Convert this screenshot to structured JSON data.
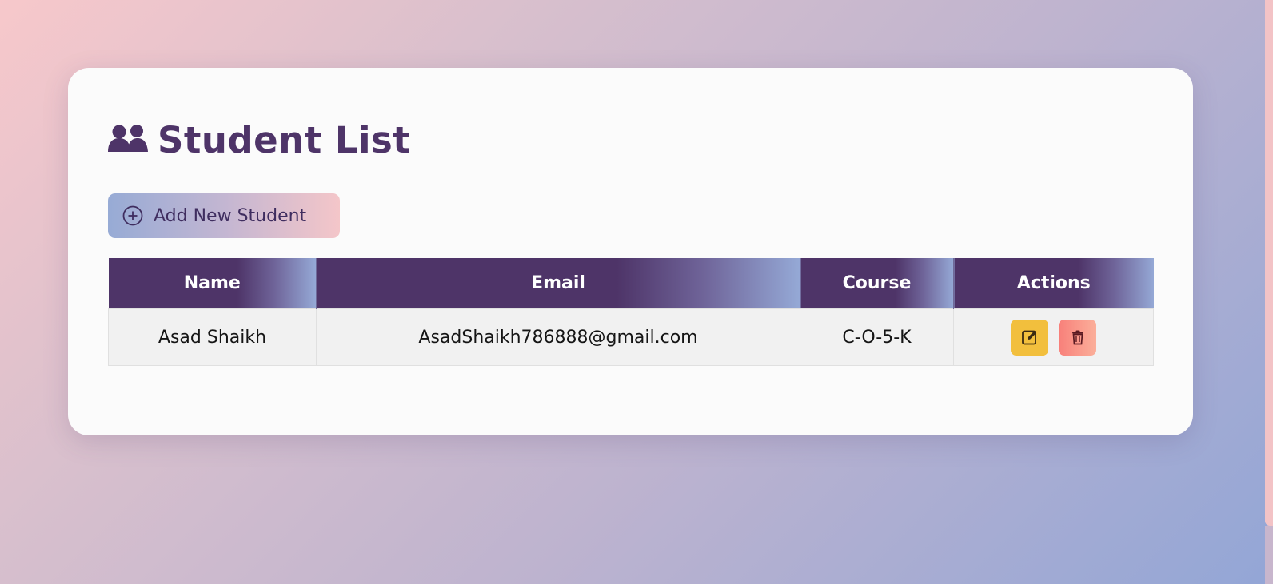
{
  "page": {
    "title": "Student List",
    "add_button_label": "Add New Student",
    "icons": {
      "title": "users-icon",
      "add": "plus-circle-icon",
      "edit": "edit-icon",
      "delete": "trash-icon"
    },
    "colors": {
      "primary": "#4e3468",
      "edit_button": "#f2bf3d",
      "delete_button": "#f8807a",
      "table_header_accent": "#95a9d6"
    }
  },
  "table": {
    "columns": [
      "Name",
      "Email",
      "Course",
      "Actions"
    ],
    "rows": [
      {
        "name": "Asad Shaikh",
        "email": "AsadShaikh786888@gmail.com",
        "course": "C-O-5-K"
      }
    ]
  }
}
